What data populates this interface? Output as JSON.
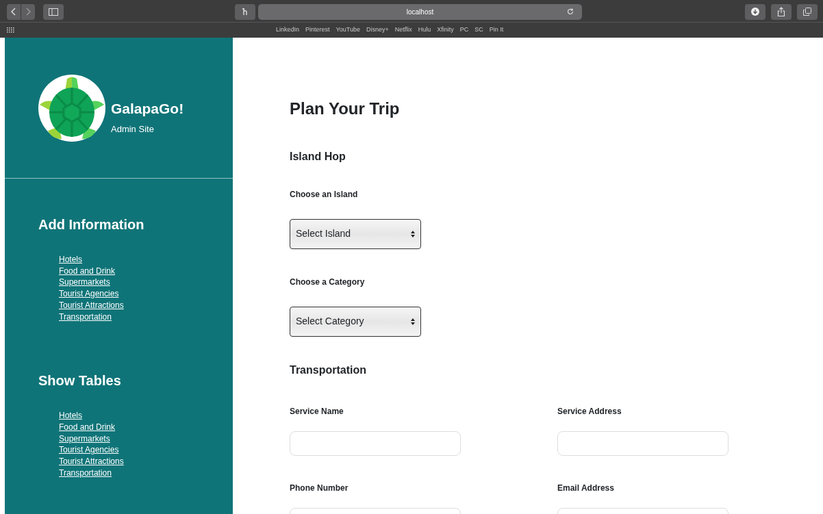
{
  "browser": {
    "url": "localhost",
    "bookmarks": [
      "LinkedIn",
      "Pinterest",
      "YouTube",
      "Disney+",
      "Netflix",
      "Hulu",
      "Xfinity",
      "PC",
      "SC",
      "Pin It"
    ]
  },
  "sidebar": {
    "brand": {
      "title": "GalapaGo!",
      "subtitle": "Admin Site"
    },
    "sections": [
      {
        "heading": "Add Information",
        "links": [
          "Hotels",
          "Food and Drink",
          "Supermarkets",
          "Tourist Agencies",
          "Tourist Attractions",
          "Transportation"
        ]
      },
      {
        "heading": "Show Tables",
        "links": [
          "Hotels",
          "Food and Drink",
          "Supermarkets",
          "Tourist Agencies",
          "Tourist Attractions",
          "Transportation"
        ]
      }
    ]
  },
  "main": {
    "title": "Plan Your Trip",
    "island_hop": {
      "heading": "Island Hop",
      "selects": [
        {
          "label": "Choose an Island",
          "value": "Select Island"
        },
        {
          "label": "Choose a Category",
          "value": "Select Category"
        }
      ]
    },
    "transportation": {
      "heading": "Transportation",
      "fields": [
        {
          "label": "Service Name"
        },
        {
          "label": "Service Address"
        },
        {
          "label": "Phone Number"
        },
        {
          "label": "Email Address"
        }
      ]
    }
  }
}
